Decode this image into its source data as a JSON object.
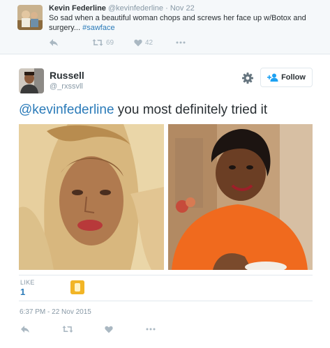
{
  "parent_tweet": {
    "name": "Kevin Federline",
    "handle": "@kevinfederline",
    "separator": "·",
    "time": "Nov 22",
    "text": "So sad when a beautiful woman chops and screws her face up w/Botox and surgery... ",
    "hashtag": "#sawface",
    "retweets": "69",
    "likes": "42"
  },
  "tweet": {
    "name": "Russell",
    "handle": "@_rxssvll",
    "follow_label": "Follow",
    "mention": "@kevinfederline",
    "text": " you most definitely tried it",
    "likes_label": "LIKE",
    "likes_count": "1",
    "timestamp": "6:37 PM - 22 Nov 2015"
  },
  "icons": {
    "reply": "reply-icon",
    "retweet": "retweet-icon",
    "like": "heart-icon",
    "more": "more-icon",
    "gear": "gear-icon",
    "follow": "follow-person-icon"
  },
  "colors": {
    "link": "#2b7bb9",
    "muted": "#8899a6",
    "icon": "#aab8c2",
    "text": "#292f33",
    "parent_bg": "#f5f8fa"
  }
}
